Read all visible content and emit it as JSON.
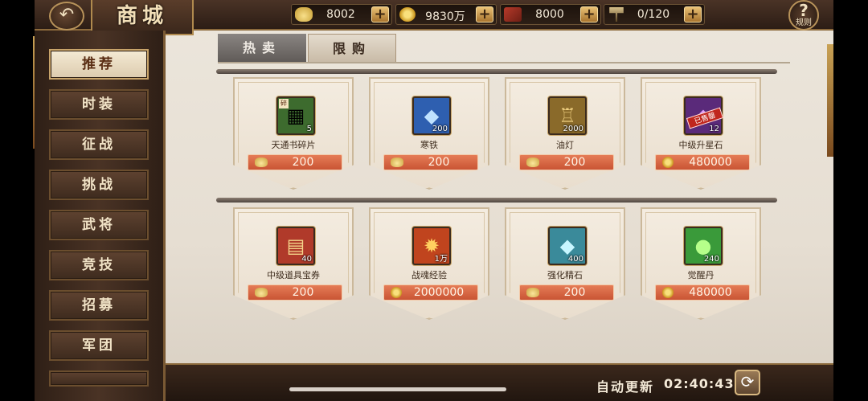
{
  "header": {
    "back_icon": "back-arrow-icon",
    "title": "商城",
    "help_label": "规则"
  },
  "resources": [
    {
      "icon": "gold-ingot-icon",
      "value": "8002"
    },
    {
      "icon": "copper-coin-icon",
      "value": "9830万"
    },
    {
      "icon": "ticket-icon",
      "value": "8000"
    },
    {
      "icon": "banner-flag-icon",
      "value": "0/120"
    }
  ],
  "sidebar": {
    "items": [
      {
        "label": "推荐",
        "active": true
      },
      {
        "label": "时装"
      },
      {
        "label": "征战"
      },
      {
        "label": "挑战"
      },
      {
        "label": "武将"
      },
      {
        "label": "竞技"
      },
      {
        "label": "招募"
      },
      {
        "label": "军团"
      }
    ]
  },
  "tabs": [
    {
      "label": "热卖",
      "active": true
    },
    {
      "label": "限购",
      "active": false
    }
  ],
  "items": [
    {
      "name": "天通书碎片",
      "qty": "5",
      "price": "200",
      "currency": "ingot",
      "color": "#3d6b2e"
    },
    {
      "name": "寒铁",
      "qty": "200",
      "price": "200",
      "currency": "ingot",
      "color": "#2e5fb0"
    },
    {
      "name": "油灯",
      "qty": "2000",
      "price": "200",
      "currency": "ingot",
      "color": "#8a6a2a"
    },
    {
      "name": "中级升星石",
      "qty": "12",
      "price": "480000",
      "currency": "coin",
      "color": "#5a2a7a",
      "stamp": "已售罄"
    },
    {
      "name": "中级道具宝券",
      "qty": "40",
      "price": "200",
      "currency": "ingot",
      "color": "#b03a2a"
    },
    {
      "name": "战魂经验",
      "qty": "1万",
      "price": "2000000",
      "currency": "coin",
      "color": "#c0441e"
    },
    {
      "name": "强化精石",
      "qty": "400",
      "price": "200",
      "currency": "ingot",
      "color": "#3a8a9a"
    },
    {
      "name": "觉醒丹",
      "qty": "240",
      "price": "480000",
      "currency": "coin",
      "color": "#3a9a3a"
    }
  ],
  "footer": {
    "refresh_label": "自动更新",
    "timer": "02:40:43"
  },
  "colors": {
    "accent": "#c95434",
    "frame": "#8c6a3c"
  }
}
